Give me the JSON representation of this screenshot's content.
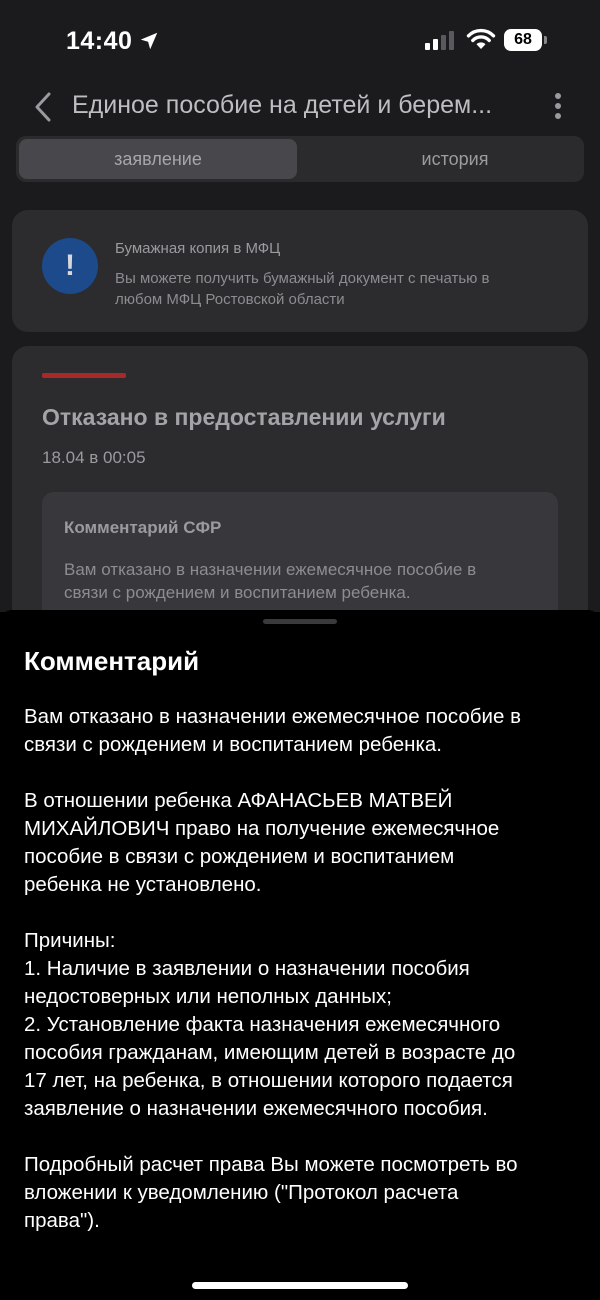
{
  "status_bar": {
    "time": "14:40",
    "battery": "68",
    "icons": [
      "location-arrow-icon",
      "cellular-signal-icon",
      "wifi-icon",
      "battery-icon"
    ]
  },
  "nav": {
    "title": "Единое пособие на детей и берем...",
    "back_icon": "chevron-left-icon",
    "more_icon": "more-vertical-icon"
  },
  "tabs": [
    {
      "label": "заявление",
      "active": true
    },
    {
      "label": "история",
      "active": false
    }
  ],
  "info_card": {
    "icon": "exclamation-circle-icon",
    "icon_color": "#1c4a8a",
    "title": "Бумажная копия в МФЦ",
    "text_lines": [
      "Вы можете получить бумажный документ с печатью в",
      "любом МФЦ Ростовской области"
    ]
  },
  "status_card": {
    "accent_color": "#a8292a",
    "title": "Отказано в предоставлении услуги",
    "date": "18.04 в 00:05",
    "comment_title": "Комментарий СФР",
    "comment_lines": [
      "Вам отказано в назначении ежемесячное пособие в",
      "связи с рождением и воспитанием ребенка."
    ]
  },
  "sheet": {
    "title": "Комментарий",
    "paragraphs": [
      [
        "Вам отказано в назначении ежемесячное пособие в",
        "связи с рождением и воспитанием ребенка."
      ],
      [
        "В отношении ребенка АФАНАСЬЕВ МАТВЕЙ",
        "МИХАЙЛОВИЧ право на получение ежемесячное",
        "пособие в связи с рождением и воспитанием",
        "ребенка не установлено."
      ],
      [
        "Причины:",
        "1. Наличие в заявлении о назначении пособия",
        "недостоверных или неполных данных;",
        "2. Установление факта назначения ежемесячного",
        "пособия гражданам, имеющим детей в возрасте до",
        "17 лет, на ребенка, в отношении которого подается",
        "заявление о назначении ежемесячного пособия."
      ],
      [
        "Подробный расчет права Вы можете посмотреть во",
        "вложении к уведомлению (\"Протокол расчета",
        "права\")."
      ]
    ]
  }
}
